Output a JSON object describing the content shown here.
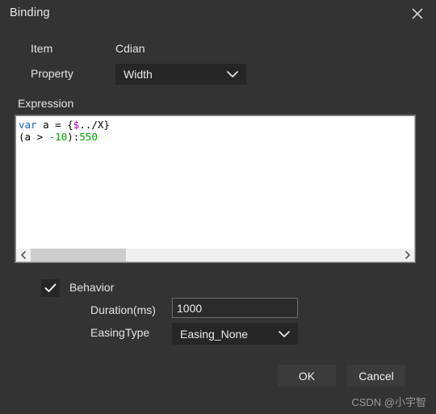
{
  "window": {
    "title": "Binding",
    "close_icon": "close-icon",
    "background_color": "#333333"
  },
  "fields": {
    "item_label": "Item",
    "item_value": "Cdian",
    "property_label": "Property",
    "property_value": "Width",
    "property_options": [
      "Width"
    ],
    "dropdown_icon": "chevron-down-icon"
  },
  "expression": {
    "label": "Expression",
    "lines": [
      [
        {
          "text": "var",
          "type": "keyword"
        },
        {
          "text": " a = {",
          "type": "plain"
        },
        {
          "text": "$",
          "type": "variable"
        },
        {
          "text": "../X}",
          "type": "plain"
        }
      ],
      [
        {
          "text": "(a > ",
          "type": "plain"
        },
        {
          "text": "-10",
          "type": "number"
        },
        {
          "text": "):",
          "type": "plain"
        },
        {
          "text": "550",
          "type": "number"
        }
      ]
    ],
    "plain_text": "var a = {$../X}\n(a > -10):550",
    "colors": {
      "keyword": "#0d63c6",
      "variable": "#b000b0",
      "number": "#00a000",
      "plain": "#000000",
      "background": "#ffffff"
    },
    "scrollbar": {
      "left_icon": "chevron-left-icon",
      "right_icon": "chevron-right-icon",
      "thumb_position": "left"
    }
  },
  "behavior": {
    "checkbox_label": "Behavior",
    "checkbox_checked": true,
    "check_icon": "check-icon",
    "duration_label": "Duration(ms)",
    "duration_value": "1000",
    "duration_placeholder": "",
    "easing_label": "EasingType",
    "easing_value": "Easing_None",
    "easing_options": [
      "Easing_None"
    ],
    "dropdown_icon": "chevron-down-icon"
  },
  "footer": {
    "ok_label": "OK",
    "cancel_label": "Cancel"
  },
  "watermark": {
    "text": "CSDN @小宇智"
  }
}
